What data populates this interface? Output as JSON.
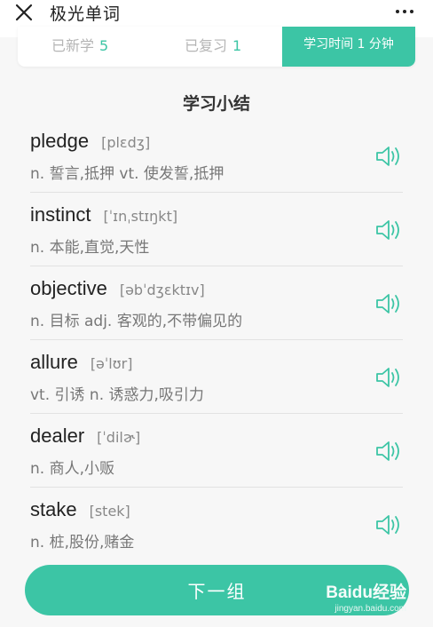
{
  "header": {
    "title": "极光单词",
    "close_icon": "close-icon",
    "more_icon": "more-icon"
  },
  "stats": {
    "new_label": "已新学",
    "new_count": "5",
    "review_label": "已复习",
    "review_count": "1",
    "time_text": "学习时间 1 分钟"
  },
  "summary": {
    "title": "学习小结",
    "words": [
      {
        "word": "pledge",
        "phonetic": "[plɛdʒ]",
        "meaning": "n. 誓言,抵押 vt. 使发誓,抵押"
      },
      {
        "word": "instinct",
        "phonetic": "[ˈɪnˌstɪŋkt]",
        "meaning": "n. 本能,直觉,天性"
      },
      {
        "word": "objective",
        "phonetic": "[əbˈdʒɛktɪv]",
        "meaning": "n. 目标 adj. 客观的,不带偏见的"
      },
      {
        "word": "allure",
        "phonetic": "[əˈlʊr]",
        "meaning": "vt. 引诱 n. 诱惑力,吸引力"
      },
      {
        "word": "dealer",
        "phonetic": "[ˈdilɚ]",
        "meaning": "n. 商人,小贩"
      },
      {
        "word": "stake",
        "phonetic": "[stek]",
        "meaning": "n. 桩,股份,赌金"
      }
    ]
  },
  "next_button": {
    "label": "下一组"
  },
  "watermark": {
    "brand": "Baidu经验",
    "site": "jingyan.baidu.com"
  },
  "colors": {
    "accent": "#3cc5a5",
    "muted": "#b5b5b5",
    "text": "#222222"
  }
}
